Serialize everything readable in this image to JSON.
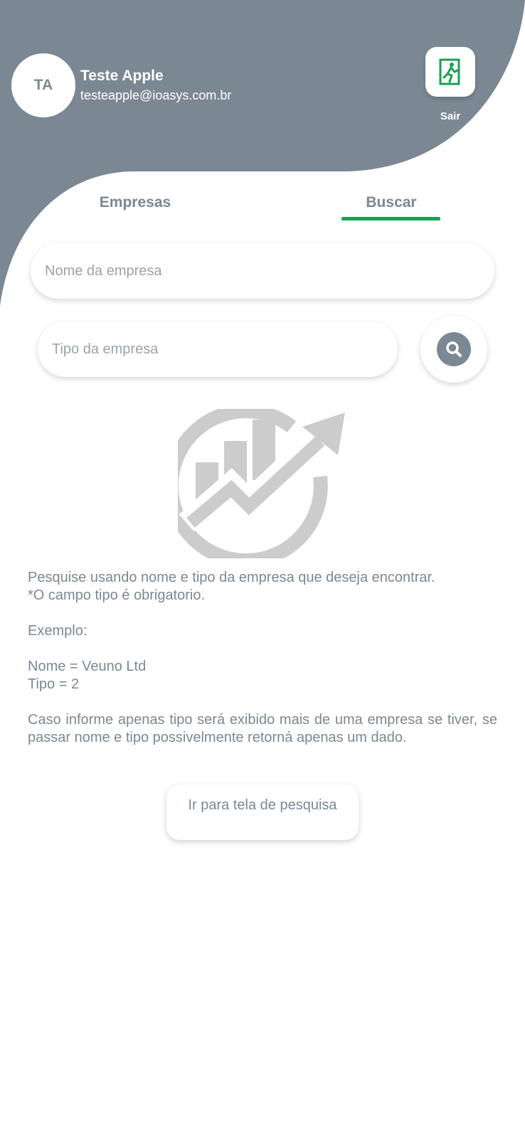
{
  "user": {
    "initials": "TA",
    "name": "Teste Apple",
    "email": "testeapple@ioasys.com.br"
  },
  "logout": {
    "label": "Sair",
    "icon": "exit-door-icon"
  },
  "tabs": [
    {
      "label": "Empresas",
      "active": false
    },
    {
      "label": "Buscar",
      "active": true
    }
  ],
  "search": {
    "name_placeholder": "Nome da empresa",
    "type_placeholder": "Tipo da empresa",
    "button_icon": "search-icon"
  },
  "help": {
    "line1": "Pesquise usando nome e tipo da empresa que deseja encontrar.",
    "line2": "*O campo tipo é obrigatorio.",
    "example_label": "Exemplo:",
    "example_name": "Nome = Veuno Ltd",
    "example_type": "Tipo = 2",
    "note": "Caso informe apenas tipo será exibido mais de uma empresa se tiver, se passar nome e tipo possivelmente retorná apenas um dado."
  },
  "goto_button": {
    "label": "Ir para tela de pesquisa"
  },
  "colors": {
    "header": "#7b8893",
    "accent": "#1aa052",
    "text": "#7b8893",
    "logo": "#cccccc"
  }
}
